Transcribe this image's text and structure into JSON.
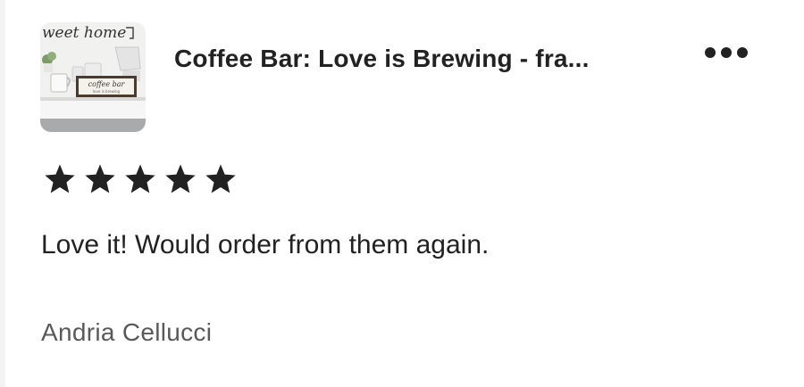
{
  "listing": {
    "title": "Coffee Bar: Love is Brewing - fra...",
    "thumbnail_script_text": "weet home",
    "thumbnail_sign_line1": "coffee bar",
    "thumbnail_sign_line2": "love is brewing"
  },
  "more_menu": {
    "icon": "more-horizontal-icon"
  },
  "rating": {
    "value": 5,
    "max": 5,
    "icon": "star-filled-icon"
  },
  "review": {
    "text": "Love it! Would order from them again."
  },
  "reviewer": {
    "name": "Andria Cellucci"
  },
  "colors": {
    "text": "#222222",
    "secondary_text": "#595959",
    "star": "#222222",
    "background": "#ffffff"
  }
}
